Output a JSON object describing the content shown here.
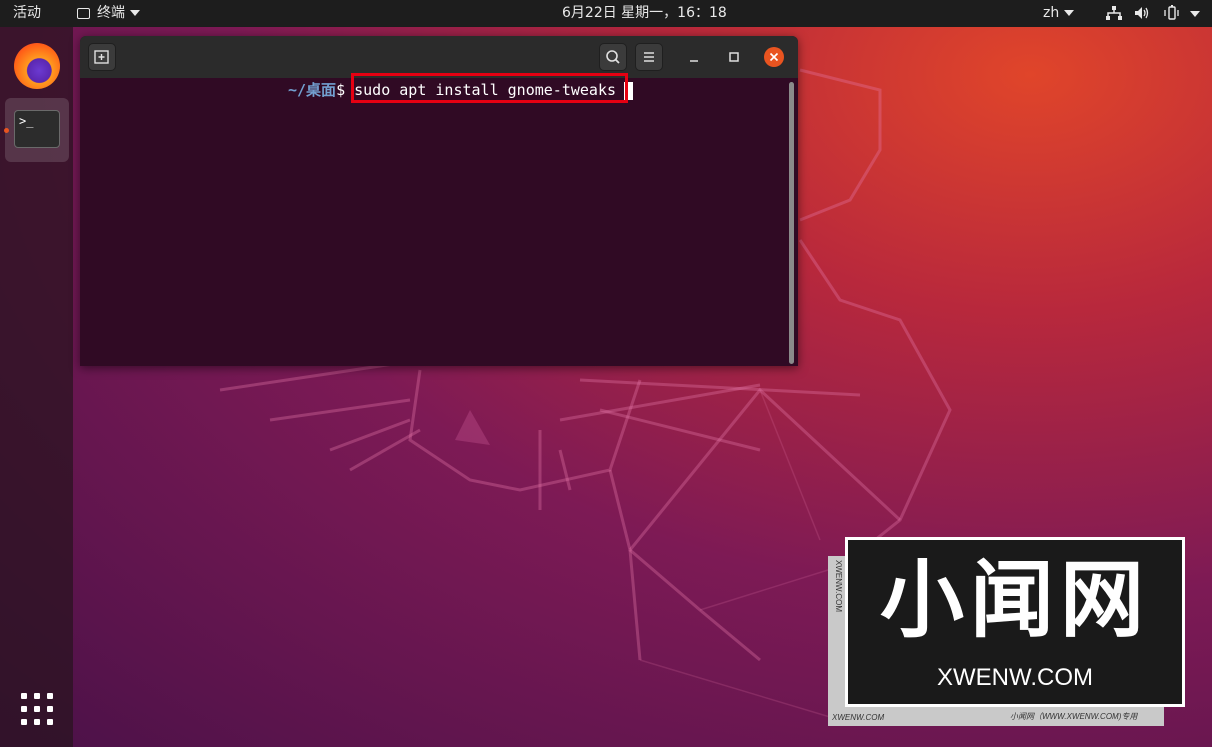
{
  "topbar": {
    "activities": "活动",
    "app_menu_label": "终端",
    "clock": "6月22日 星期一，16：18",
    "input_method": "zh"
  },
  "dock": {
    "apps": [
      {
        "name": "Firefox",
        "icon": "firefox-icon"
      },
      {
        "name": "Terminal",
        "icon": "terminal-icon",
        "running": true
      }
    ],
    "terminal_icon_text": ">_",
    "show_apps_icon": "grid-icon"
  },
  "terminal": {
    "prompt_path": "~/桌面",
    "prompt_symbol": "$ ",
    "command": "sudo apt install gnome-tweaks",
    "highlight_color": "#e60012",
    "background_color": "#300a24"
  },
  "watermark": {
    "big_text": "小闻网",
    "small_text": "XWENW.COM",
    "side_text": "XWENW.COM",
    "bottom_left": "XWENW.COM",
    "bottom_right": "小闻网（WWW.XWENW.COM)专用"
  }
}
